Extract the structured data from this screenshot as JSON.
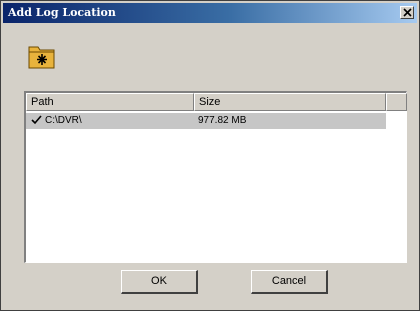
{
  "window": {
    "title": "Add Log Location"
  },
  "icons": {
    "folder": "folder-icon",
    "close": "close-icon",
    "check": "check-icon"
  },
  "list": {
    "columns": [
      "Path",
      "Size"
    ],
    "rows": [
      {
        "checked": true,
        "path": "C:\\DVR\\",
        "size": "977.82 MB"
      }
    ]
  },
  "buttons": {
    "ok_label": "OK",
    "cancel_label": "Cancel"
  },
  "colors": {
    "titlebar_start": "#0a246a",
    "titlebar_end": "#a6caf0",
    "face": "#d4d0c8",
    "selected_row": "#c6c6c6"
  }
}
